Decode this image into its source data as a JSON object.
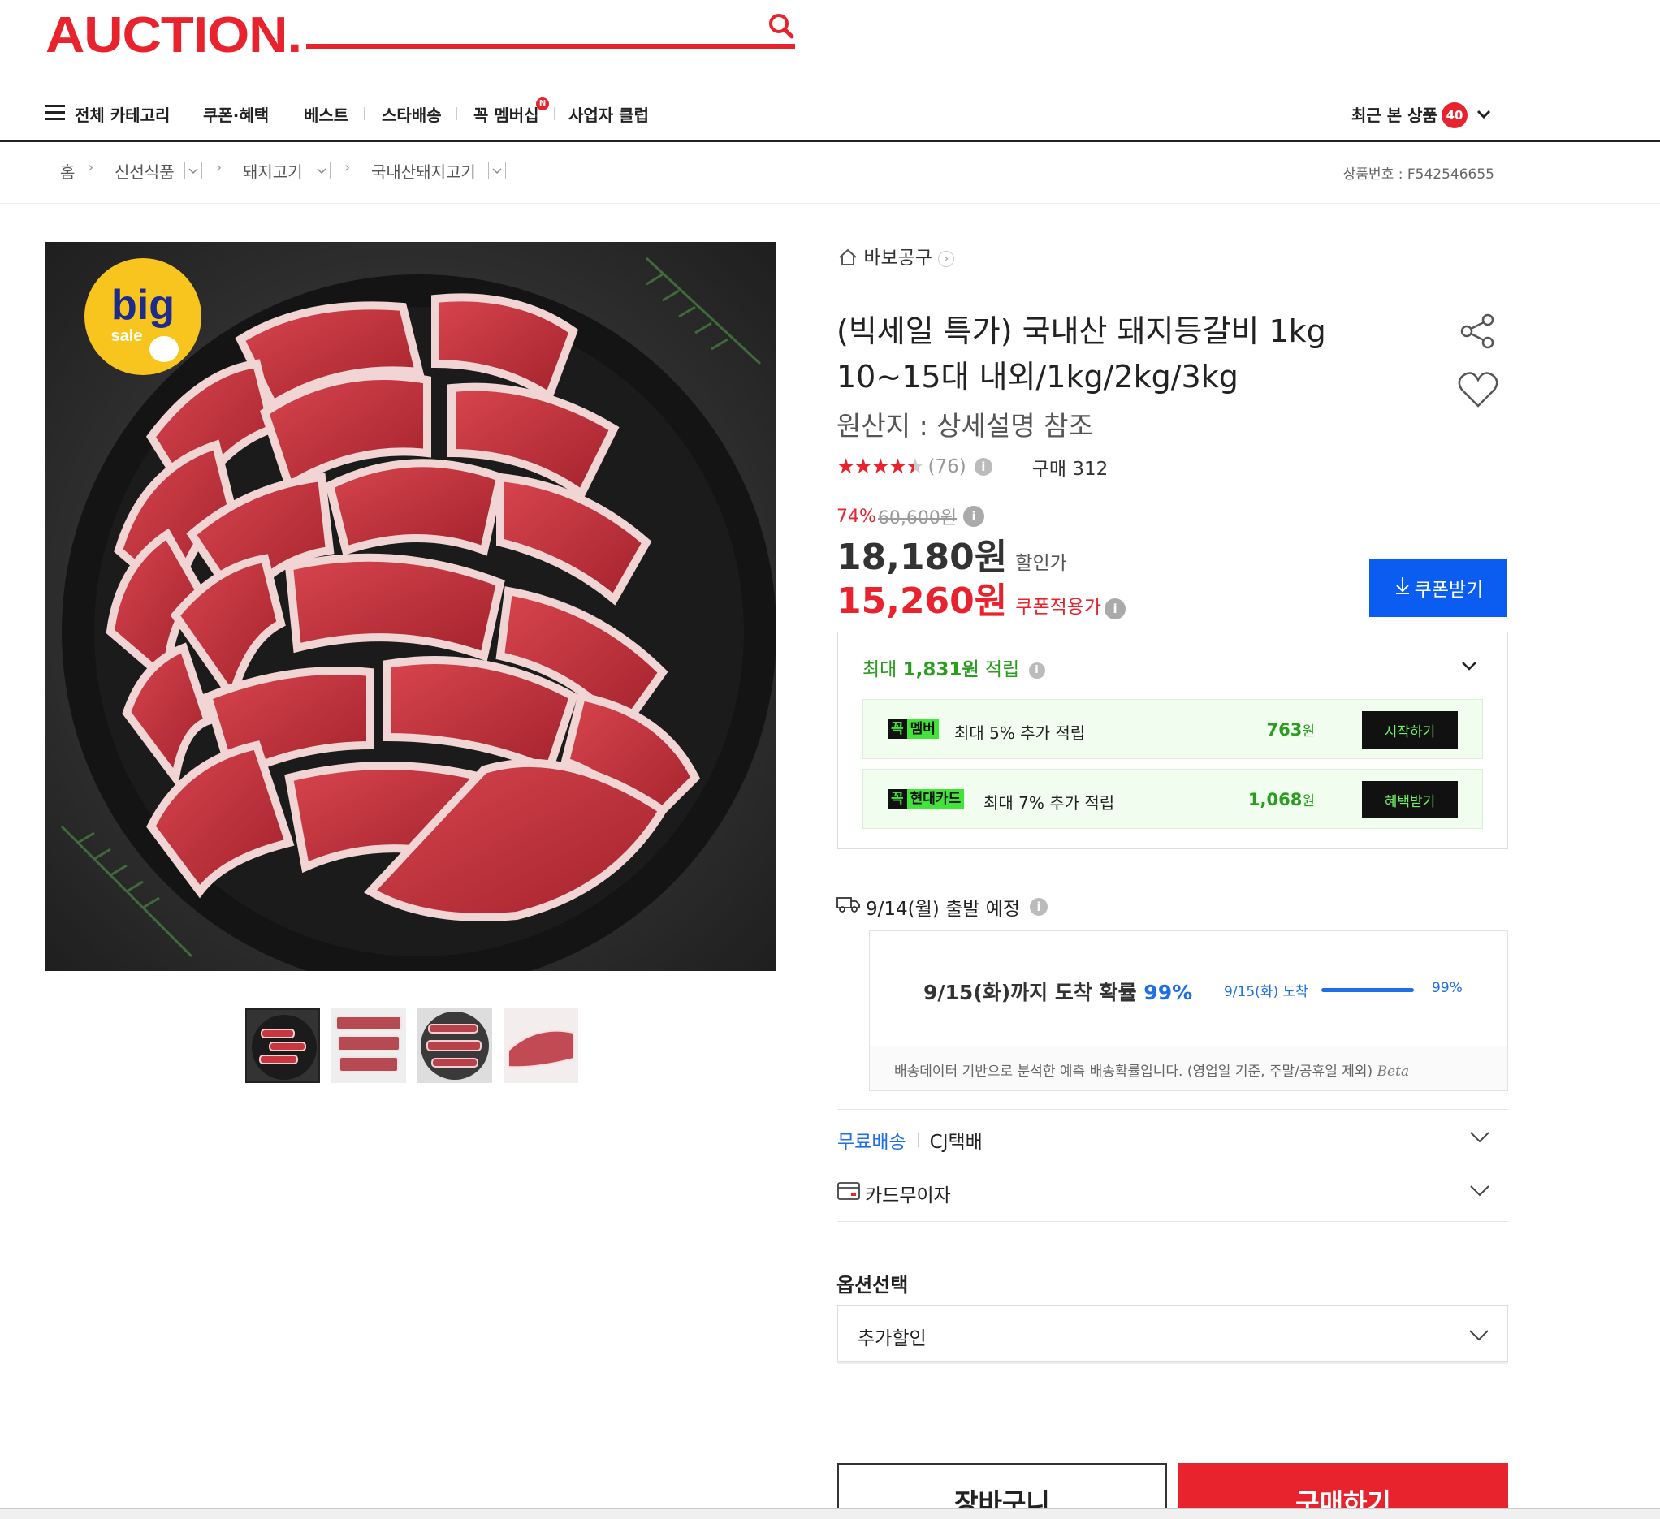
{
  "header": {
    "logo": "AUCTION.",
    "nav": [
      "쿠폰·혜택",
      "베스트",
      "스타배송",
      "꼭 멤버십",
      "사업자 클럽"
    ],
    "all_category": "전체 카테고리",
    "membership_badge": "N",
    "recent_label": "최근 본 상품",
    "recent_count": "40"
  },
  "breadcrumb": {
    "home": "홈",
    "items": [
      "신선식품",
      "돼지고기",
      "국내산돼지고기"
    ],
    "product_no_label": "상품번호 : F542546655"
  },
  "image": {
    "badge_top": "big",
    "badge_bottom": "sale"
  },
  "product": {
    "store": "바보공구",
    "title": "(빅세일 특가) 국내산 돼지등갈비 1kg 10~15대 내외/1kg/2kg/3kg",
    "origin": "원산지 : 상세설명 참조",
    "rating": 4.5,
    "review_count": "(76)",
    "buy_count": "구매 312",
    "discount_rate": "74%",
    "original_price": "60,600원",
    "sale_price": "18,180원",
    "sale_label": "할인가",
    "coupon_price": "15,260원",
    "coupon_label": "쿠폰적용가",
    "coupon_button": "쿠폰받기"
  },
  "points": {
    "title_prefix": "최대",
    "title_amount": "1,831원",
    "title_suffix": "적립",
    "rows": [
      {
        "badge_a": "꼭",
        "badge_b": "멤버",
        "text": "최대 5% 추가 적립",
        "amount": "763",
        "unit": "원",
        "button": "시작하기"
      },
      {
        "badge_a": "꼭",
        "badge_b": "현대카드",
        "text": "최대 7% 추가 적립",
        "amount": "1,068",
        "unit": "원",
        "button": "혜택받기"
      }
    ]
  },
  "shipping": {
    "depart": "9/14(월) 출발 예정",
    "arrive_prefix": "9/15(화)까지 도착 확률",
    "arrive_pct": "99%",
    "arrive_small": "9/15(화) 도착",
    "arrive_small_pct": "99%",
    "arrive_fraction": 0.99,
    "note": "배송데이터 기반으로 분석한 예측 배송확률입니다. (영업일 기준, 주말/공휴일 제외)",
    "beta": "Beta",
    "free": "무료배송",
    "carrier": "CJ택배",
    "card": "카드무이자"
  },
  "options": {
    "title": "옵션선택",
    "selected": "추가할인"
  },
  "actions": {
    "cart": "장바구니",
    "buy": "구매하기"
  },
  "colors": {
    "brand": "#e8232d",
    "coupon_blue": "#0a5df0",
    "point_green": "#2a9d1f"
  }
}
